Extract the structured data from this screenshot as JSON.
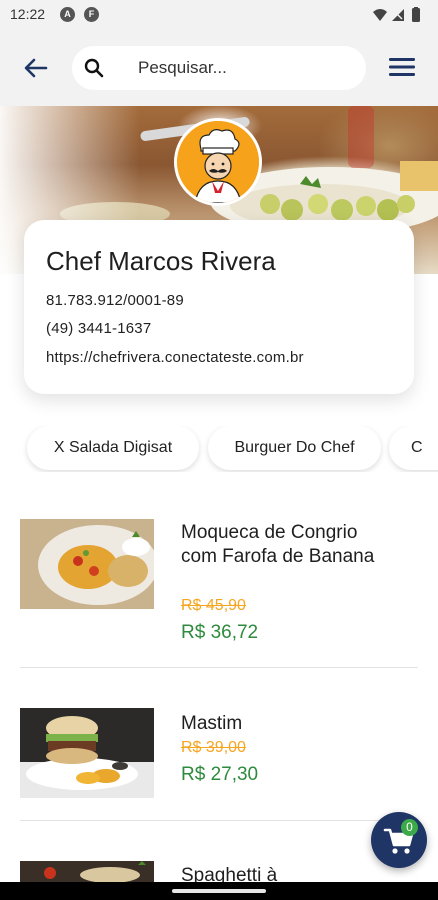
{
  "status_bar": {
    "time": "12:22",
    "left_icons": [
      "A",
      "F"
    ],
    "right_icons": [
      "wifi-icon",
      "signal-icon",
      "battery-icon"
    ]
  },
  "top_bar": {
    "back_icon": "arrow-left-icon",
    "search": {
      "placeholder": "Pesquisar...",
      "value": "",
      "icon": "search-icon"
    },
    "menu_icon": "hamburger-menu-icon"
  },
  "store": {
    "name": "Chef Marcos Rivera",
    "document": "81.783.912/0001-89",
    "phone": "(49) 3441-1637",
    "website": "https://chefrivera.conectateste.com.br"
  },
  "categories": [
    {
      "label": "X Salada Digisat"
    },
    {
      "label": "Burguer Do Chef"
    },
    {
      "label": "C"
    }
  ],
  "products": [
    {
      "name": "Moqueca de Congrio com Farofa de Banana",
      "old_price": "R$ 45,90",
      "new_price": "R$ 36,72"
    },
    {
      "name": "Mastim",
      "old_price": "R$ 39,00",
      "new_price": "R$ 27,30"
    },
    {
      "name": "Spaghetti à",
      "old_price": "",
      "new_price": ""
    }
  ],
  "cart": {
    "count": "0",
    "icon": "shopping-cart-icon"
  },
  "colors": {
    "accent": "#1f3566",
    "old_price": "#f5a623",
    "new_price": "#2e8b3d",
    "badge": "#3daa4a",
    "logo_bg": "#f7a21b"
  }
}
